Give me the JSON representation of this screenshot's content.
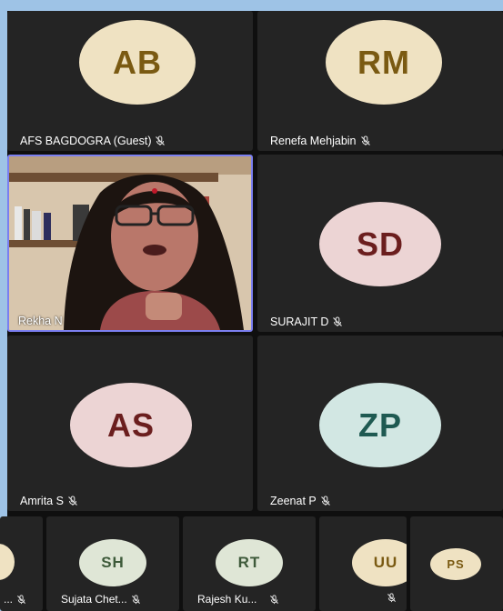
{
  "colors": {
    "background": "#9ec3e6",
    "tile": "#242424",
    "active_speaker_border": "#7b7ff0"
  },
  "participants": [
    {
      "initials": "AB",
      "name": "AFS BAGDOGRA (Guest)",
      "muted": true,
      "avatar_bg": "#efe2c2",
      "avatar_fg": "#7a5a12"
    },
    {
      "initials": "RM",
      "name": "Renefa Mehjabin",
      "muted": true,
      "avatar_bg": "#efe2c2",
      "avatar_fg": "#7a5a12"
    },
    {
      "initials": "",
      "name": "Rekha N",
      "muted": false,
      "video": true
    },
    {
      "initials": "SD",
      "name": "SURAJIT D",
      "muted": true,
      "avatar_bg": "#ecd4d4",
      "avatar_fg": "#6b1e1e"
    },
    {
      "initials": "AS",
      "name": "Amrita S",
      "muted": true,
      "avatar_bg": "#ecd4d4",
      "avatar_fg": "#6b1e1e"
    },
    {
      "initials": "ZP",
      "name": "Zeenat P",
      "muted": true,
      "avatar_bg": "#d2e7e3",
      "avatar_fg": "#1f5a52"
    }
  ],
  "thumbnails": [
    {
      "initials": "",
      "name": "...",
      "muted": true
    },
    {
      "initials": "SH",
      "name": "Sujata Chet...",
      "muted": true,
      "avatar_bg": "#dfe6d6",
      "avatar_fg": "#3e5a3a"
    },
    {
      "initials": "RT",
      "name": "Rajesh Ku...",
      "muted": true,
      "avatar_bg": "#dfe6d6",
      "avatar_fg": "#3e5a3a"
    },
    {
      "initials": "UU",
      "name": "",
      "muted": true,
      "avatar_bg": "#efe2c2",
      "avatar_fg": "#7a5a12"
    },
    {
      "initials": "PS",
      "name": "",
      "muted": false,
      "avatar_bg": "#efe2c2",
      "avatar_fg": "#7a5a12"
    }
  ]
}
